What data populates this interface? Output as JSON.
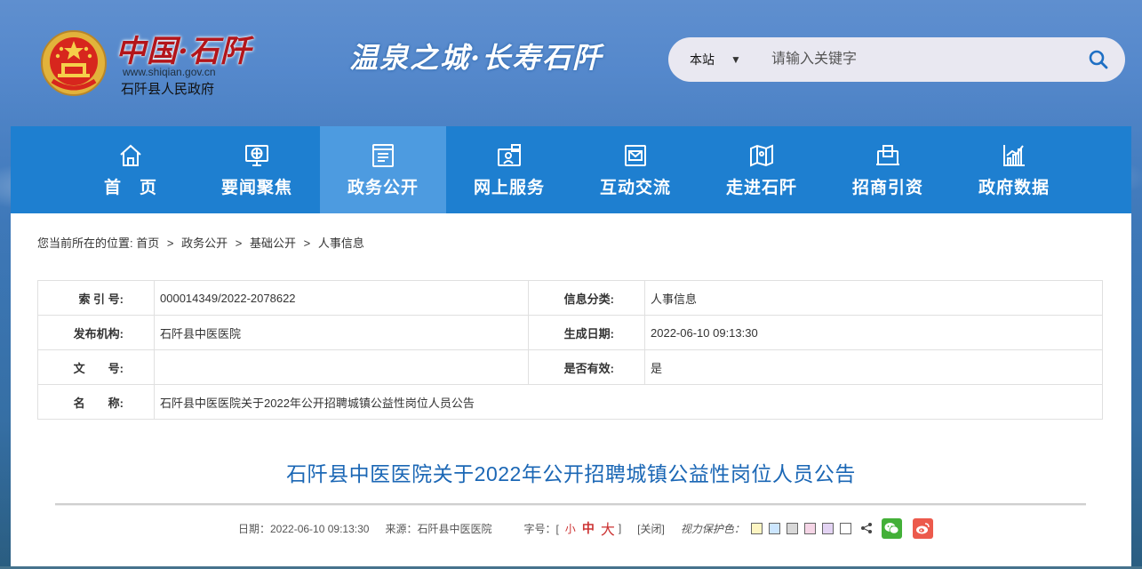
{
  "header": {
    "logo_title": "中国·石阡",
    "logo_url": "www.shiqian.gov.cn",
    "logo_subtitle": "石阡县人民政府",
    "slogan": "温泉之城·长寿石阡",
    "search": {
      "scope": "本站",
      "placeholder": "请输入关键字"
    }
  },
  "nav": {
    "items": [
      {
        "label": "首　页",
        "icon": "home-icon"
      },
      {
        "label": "要闻聚焦",
        "icon": "globe-monitor-icon"
      },
      {
        "label": "政务公开",
        "icon": "document-list-icon",
        "active": true
      },
      {
        "label": "网上服务",
        "icon": "service-person-icon"
      },
      {
        "label": "互动交流",
        "icon": "mail-icon"
      },
      {
        "label": "走进石阡",
        "icon": "map-icon"
      },
      {
        "label": "招商引资",
        "icon": "briefcase-icon"
      },
      {
        "label": "政府数据",
        "icon": "bar-chart-icon"
      }
    ]
  },
  "breadcrumb": {
    "prefix": "您当前所在的位置:",
    "items": [
      "首页",
      "政务公开",
      "基础公开",
      "人事信息"
    ]
  },
  "info": {
    "index_label": "索 引 号:",
    "index_value": "000014349/2022-2078622",
    "category_label": "信息分类:",
    "category_value": "人事信息",
    "publisher_label": "发布机构:",
    "publisher_value": "石阡县中医医院",
    "date_label": "生成日期:",
    "date_value": "2022-06-10 09:13:30",
    "docno_label": "文　　号:",
    "docno_value": "",
    "valid_label": "是否有效:",
    "valid_value": "是",
    "name_label": "名　　称:",
    "name_value": "石阡县中医医院关于2022年公开招聘城镇公益性岗位人员公告"
  },
  "article": {
    "title": "石阡县中医医院关于2022年公开招聘城镇公益性岗位人员公告",
    "date_text": "日期：2022-06-10 09:13:30",
    "source_text": "来源：石阡县中医医院",
    "font_size_label": "字号：[",
    "font_small": "小",
    "font_mid": "中",
    "font_big": "大",
    "font_close": "]",
    "close_label": "[关闭]",
    "vision_label": "视力保护色：",
    "swatches": [
      "#fdf5c2",
      "#cce6ff",
      "#d8d8d8",
      "#f5d5e6",
      "#e3d3f3",
      "#ffffff"
    ]
  },
  "colors": {
    "nav_bg": "#1e7fd0",
    "nav_active": "#4d9be0",
    "title_blue": "#1b67b5",
    "font_size_red": "#cc3333"
  }
}
